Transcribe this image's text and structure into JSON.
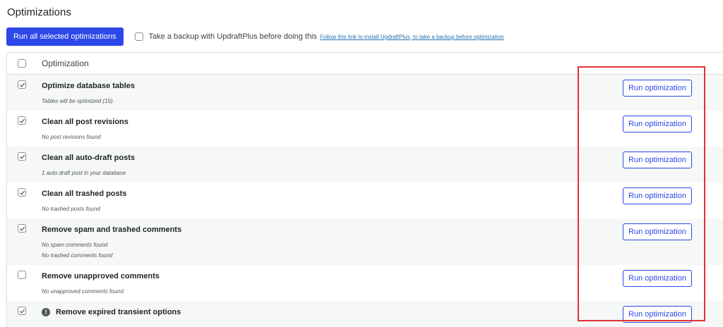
{
  "page": {
    "title": "Optimizations"
  },
  "toolbar": {
    "run_all_label": "Run all selected optimizations",
    "backup_label": "Take a backup with UpdraftPlus before doing this",
    "backup_link": "Follow this link to install UpdraftPlus, to take a backup before optimization"
  },
  "table": {
    "header_label": "Optimization",
    "rows": [
      {
        "title": "Optimize database tables",
        "info": [
          "Tables will be optimized (15)."
        ],
        "checked": true,
        "button": "Run optimization"
      },
      {
        "title": "Clean all post revisions",
        "info": [
          "No post revisions found"
        ],
        "checked": true,
        "button": "Run optimization"
      },
      {
        "title": "Clean all auto-draft posts",
        "info": [
          "1 auto draft post in your database"
        ],
        "checked": true,
        "button": "Run optimization"
      },
      {
        "title": "Clean all trashed posts",
        "info": [
          "No trashed posts found"
        ],
        "checked": true,
        "button": "Run optimization"
      },
      {
        "title": "Remove spam and trashed comments",
        "info": [
          "No spam comments found",
          "No trashed comments found"
        ],
        "checked": true,
        "button": "Run optimization"
      },
      {
        "title": "Remove unapproved comments",
        "info": [
          "No unapproved comments found"
        ],
        "checked": false,
        "button": "Run optimization"
      },
      {
        "title": "Remove expired transient options",
        "info": [],
        "checked": true,
        "warning": true,
        "button": "Run optimization"
      }
    ]
  },
  "colors": {
    "accent": "#2c48e8",
    "highlight": "#e0313a",
    "row_alt": "#f6f7f7"
  },
  "icons": {
    "check": "checkmark-icon",
    "warning": "exclamation-icon"
  }
}
